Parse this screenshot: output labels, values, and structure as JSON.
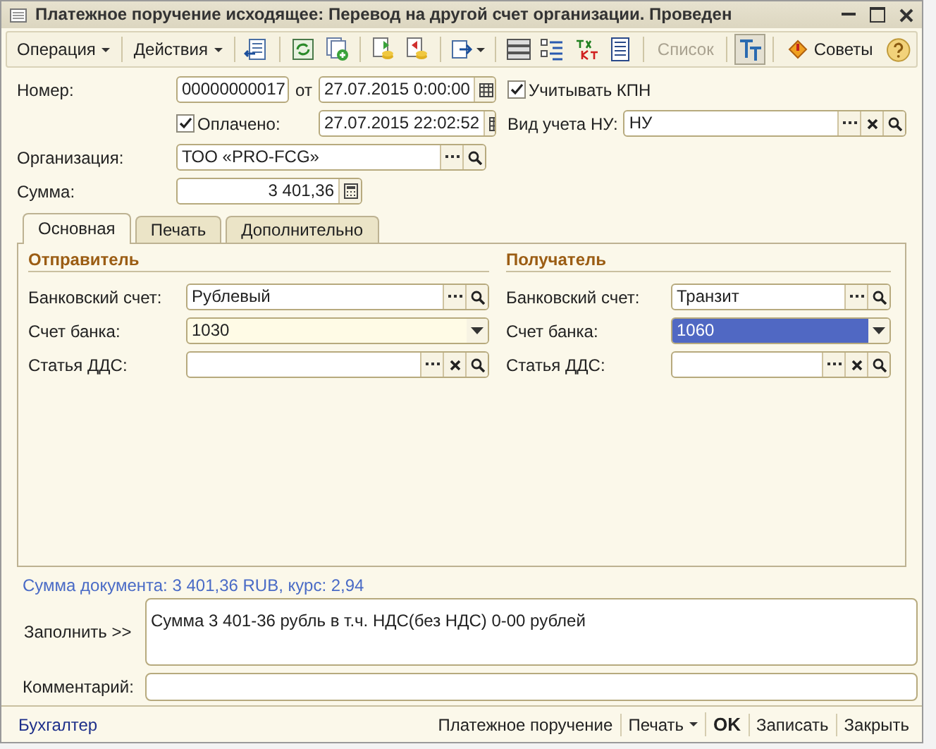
{
  "window": {
    "title": "Платежное поручение исходящее: Перевод на другой счет организации. Проведен"
  },
  "toolbar": {
    "menus": [
      "Операция",
      "Действия"
    ],
    "list_button": {
      "label": "Список",
      "disabled": true
    },
    "filter_pressed": true,
    "tips_button": "Советы"
  },
  "header": {
    "number": {
      "label": "Номер:",
      "value": "00000000017"
    },
    "date_sep": "от",
    "date": "27.07.2015  0:00:00",
    "kpn": {
      "label": "Учитывать КПН",
      "checked": true
    },
    "paid": {
      "label": "Оплачено:",
      "checked": true,
      "date": "27.07.2015 22:02:52"
    },
    "tax_view": {
      "label": "Вид учета НУ:",
      "value": "НУ"
    },
    "organization": {
      "label": "Организация:",
      "value": "ТОО «PRO-FCG»"
    },
    "amount": {
      "label": "Сумма:",
      "value": "3 401,36"
    }
  },
  "tabs": [
    {
      "label": "Основная",
      "selected": true
    },
    {
      "label": "Печать",
      "selected": false
    },
    {
      "label": "Дополнительно",
      "selected": false
    }
  ],
  "sections": [
    {
      "title": "Отправитель",
      "fields": [
        {
          "kind": "ref",
          "label": "Банковский счет:",
          "value": "Рублевый",
          "clear": false
        },
        {
          "kind": "combo",
          "label": "Счет банка:",
          "value": "1030",
          "selected": false
        },
        {
          "kind": "ref",
          "label": "Статья ДДС:",
          "clear": true
        }
      ]
    },
    {
      "title": "Получатель",
      "fields": [
        {
          "kind": "ref",
          "label": "Банковский счет:",
          "value": "Транзит",
          "clear": false
        },
        {
          "kind": "combo",
          "label": "Счет банка:",
          "value": "1060",
          "selected": true
        },
        {
          "kind": "ref",
          "label": "Статья ДДС:",
          "clear": true
        }
      ]
    }
  ],
  "summary": "Сумма документа: 3 401,36 RUB, курс: 2,94",
  "fill": {
    "button": "Заполнить >>",
    "text": "Сумма 3 401-36 рубль в т.ч. НДС(без НДС) 0-00 рублей"
  },
  "comment": {
    "label": "Комментарий:"
  },
  "status": {
    "user": "Бухгалтер",
    "buttons": [
      {
        "label": "Платежное поручение",
        "kind": "plain"
      },
      {
        "label": "Печать",
        "kind": "menu"
      },
      {
        "label": "OK",
        "kind": "default"
      },
      {
        "label": "Записать",
        "kind": "plain"
      },
      {
        "label": "Закрыть",
        "kind": "plain"
      }
    ]
  }
}
